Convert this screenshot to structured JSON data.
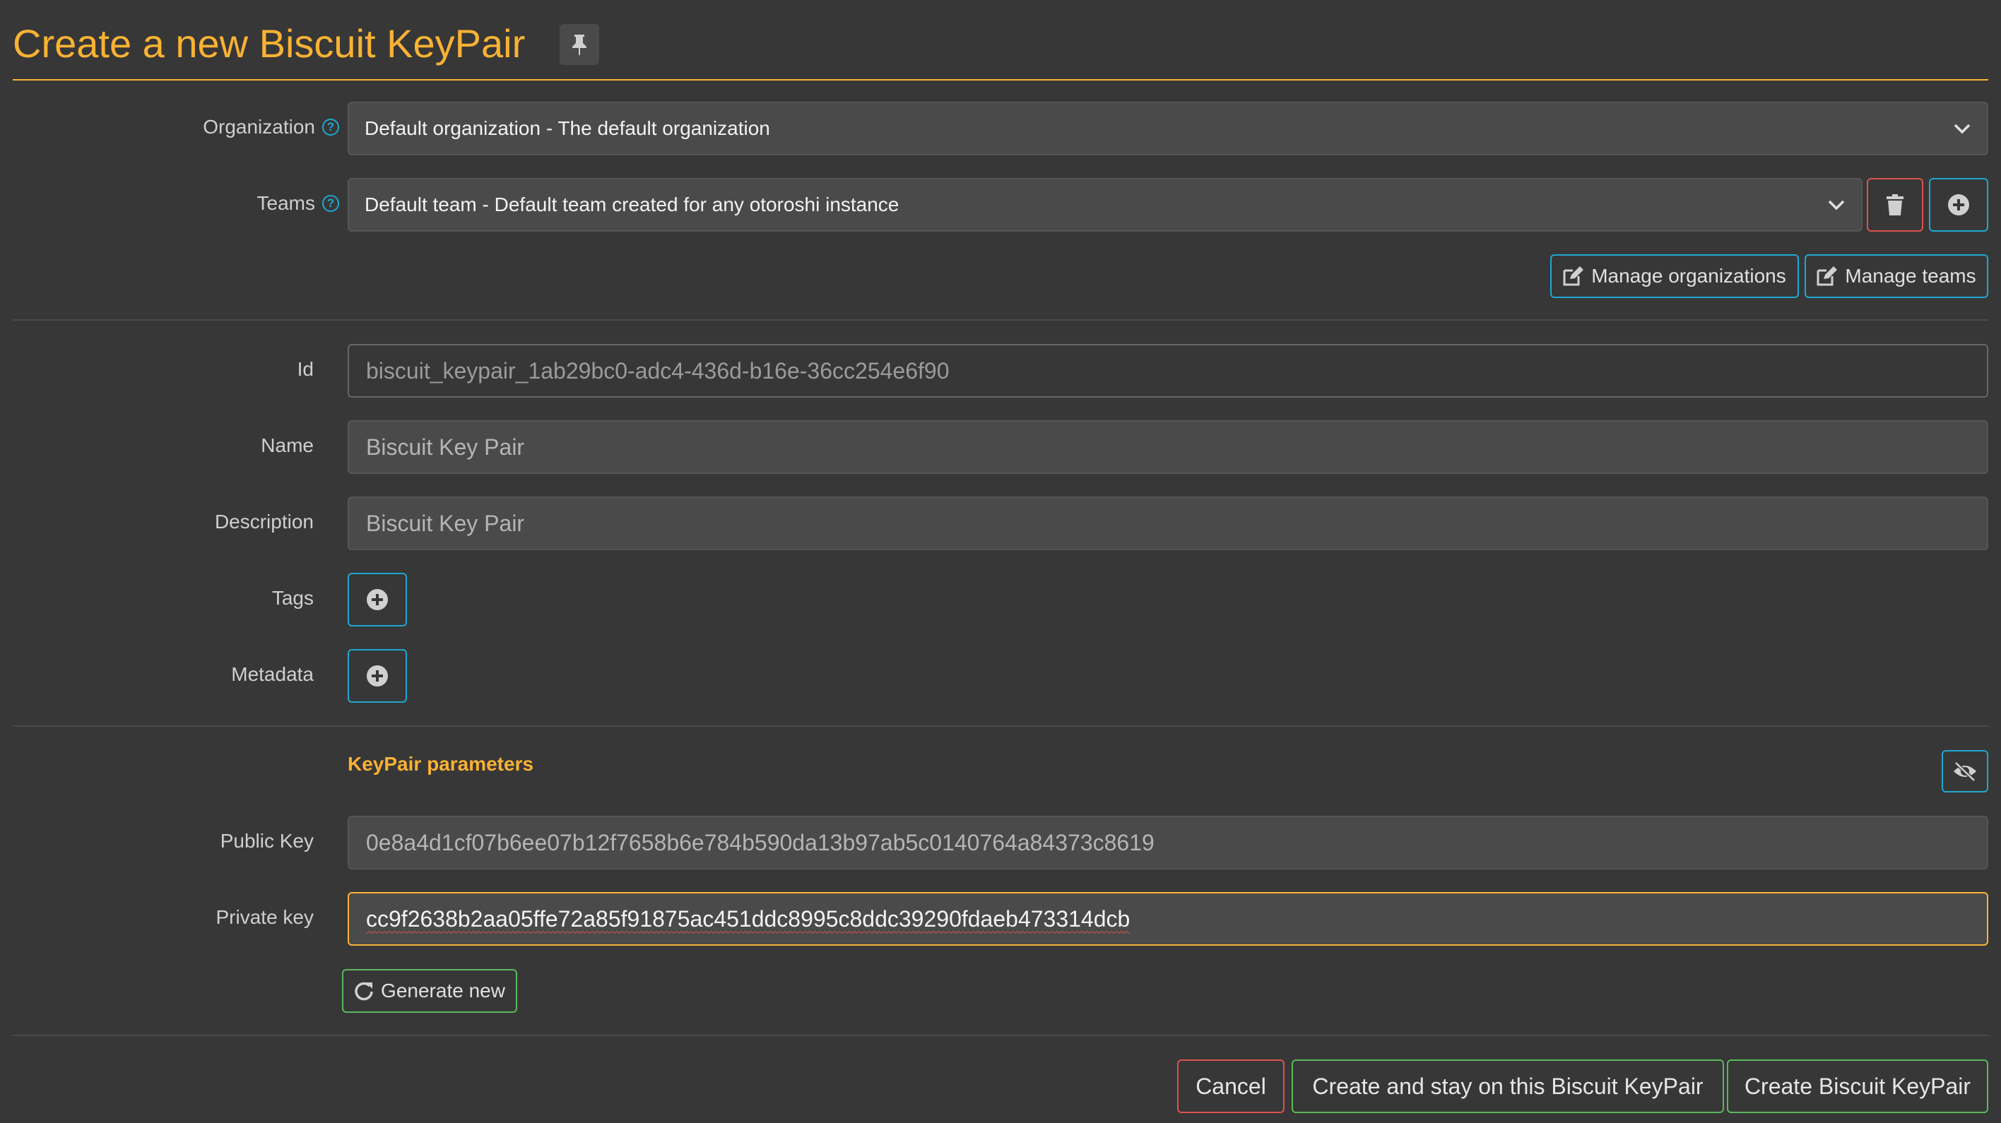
{
  "page": {
    "title": "Create a new Biscuit KeyPair"
  },
  "organization": {
    "label": "Organization",
    "value": "Default organization - The default organization"
  },
  "teams": {
    "label": "Teams",
    "value": "Default team - Default team created for any otoroshi instance"
  },
  "manage": {
    "organizations": "Manage organizations",
    "teams": "Manage teams"
  },
  "fields": {
    "id": {
      "label": "Id",
      "placeholder": "biscuit_keypair_1ab29bc0-adc4-436d-b16e-36cc254e6f90"
    },
    "name": {
      "label": "Name",
      "value": "Biscuit Key Pair"
    },
    "description": {
      "label": "Description",
      "value": "Biscuit Key Pair"
    },
    "tags": {
      "label": "Tags"
    },
    "metadata": {
      "label": "Metadata"
    }
  },
  "keypair": {
    "section_title": "KeyPair parameters",
    "public_key": {
      "label": "Public Key",
      "value": "0e8a4d1cf07b6ee07b12f7658b6e784b590da13b97ab5c0140764a84373c8619"
    },
    "private_key": {
      "label": "Private key",
      "value": "cc9f2638b2aa05ffe72a85f91875ac451ddc8995c8ddc39290fdaeb473314dcb"
    },
    "generate_label": "Generate new"
  },
  "actions": {
    "cancel": "Cancel",
    "create_and_stay": "Create and stay on this Biscuit KeyPair",
    "create": "Create Biscuit KeyPair"
  },
  "colors": {
    "accent": "#f9b233",
    "info": "#1ea8d0",
    "danger": "#d9534f",
    "success": "#5cb85c",
    "background": "#373737"
  }
}
